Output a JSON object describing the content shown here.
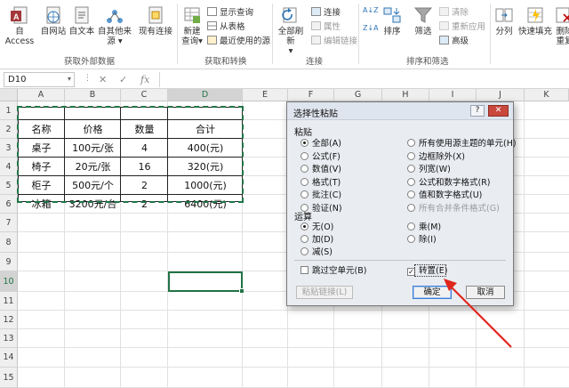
{
  "ribbon": {
    "get_external": {
      "label": "获取外部数据",
      "items": [
        "自 Access",
        "自网站",
        "自文本",
        "自其他来源",
        "现有连接"
      ]
    },
    "get_transform": {
      "label": "获取和转换",
      "new_query_line1": "新建",
      "new_query_line2": "查询",
      "small": [
        "显示查询",
        "从表格",
        "最近使用的源"
      ]
    },
    "connections": {
      "label": "连接",
      "refresh_all_line1": "全部刷新",
      "small": [
        "连接",
        "属性",
        "编辑链接"
      ]
    },
    "sort_filter": {
      "label": "排序和筛选",
      "sort": "排序",
      "filter": "筛选",
      "small": [
        "清除",
        "重新应用",
        "高级"
      ]
    },
    "tools": {
      "split": "分列",
      "flash_fill": "快速填充",
      "remove_dup_line1": "删除",
      "remove_dup_line2": "重复"
    }
  },
  "formula_bar": {
    "name_box": "D10",
    "cancel": "✕",
    "enter": "✓",
    "fx": "fx"
  },
  "columns": [
    "A",
    "B",
    "C",
    "D",
    "E",
    "F",
    "G",
    "H",
    "I",
    "J",
    "K"
  ],
  "rows": [
    "1",
    "2",
    "3",
    "4",
    "5",
    "6",
    "7",
    "8",
    "9",
    "10",
    "11",
    "12",
    "13",
    "14",
    "15"
  ],
  "table": [
    [
      "名称",
      "价格",
      "数量",
      "合计"
    ],
    [
      "桌子",
      "100元/张",
      "4",
      "400(元)"
    ],
    [
      "椅子",
      "20元/张",
      "16",
      "320(元)"
    ],
    [
      "柜子",
      "500元/个",
      "2",
      "1000(元)"
    ],
    [
      "冰箱",
      "3200元/台",
      "2",
      "6400(元)"
    ]
  ],
  "dialog": {
    "title": "选择性粘贴",
    "help_btn": "?",
    "close_btn": "✕",
    "paste_section": "粘贴",
    "paste_left": [
      {
        "label": "全部(A)",
        "selected": true
      },
      {
        "label": "公式(F)",
        "selected": false
      },
      {
        "label": "数值(V)",
        "selected": false
      },
      {
        "label": "格式(T)",
        "selected": false
      },
      {
        "label": "批注(C)",
        "selected": false
      },
      {
        "label": "验证(N)",
        "selected": false
      }
    ],
    "paste_right": [
      {
        "label": "所有使用源主题的单元(H)",
        "selected": false,
        "disabled": false
      },
      {
        "label": "边框除外(X)",
        "selected": false,
        "disabled": false
      },
      {
        "label": "列宽(W)",
        "selected": false,
        "disabled": false
      },
      {
        "label": "公式和数字格式(R)",
        "selected": false,
        "disabled": false
      },
      {
        "label": "值和数字格式(U)",
        "selected": false,
        "disabled": false
      },
      {
        "label": "所有合并条件格式(G)",
        "selected": false,
        "disabled": true
      }
    ],
    "op_section": "运算",
    "op_left": [
      {
        "label": "无(O)",
        "selected": true
      },
      {
        "label": "加(D)",
        "selected": false
      },
      {
        "label": "减(S)",
        "selected": false
      }
    ],
    "op_right": [
      {
        "label": "乘(M)",
        "selected": false
      },
      {
        "label": "除(I)",
        "selected": false
      }
    ],
    "skip_blanks": {
      "label": "跳过空单元(B)",
      "checked": false
    },
    "transpose": {
      "label": "转置(E)",
      "checked": true
    },
    "paste_link": "粘贴链接(L)",
    "ok": "确定",
    "cancel": "取消"
  },
  "colors": {
    "excel_green": "#217346",
    "annotation_arrow": "#e0261d"
  }
}
